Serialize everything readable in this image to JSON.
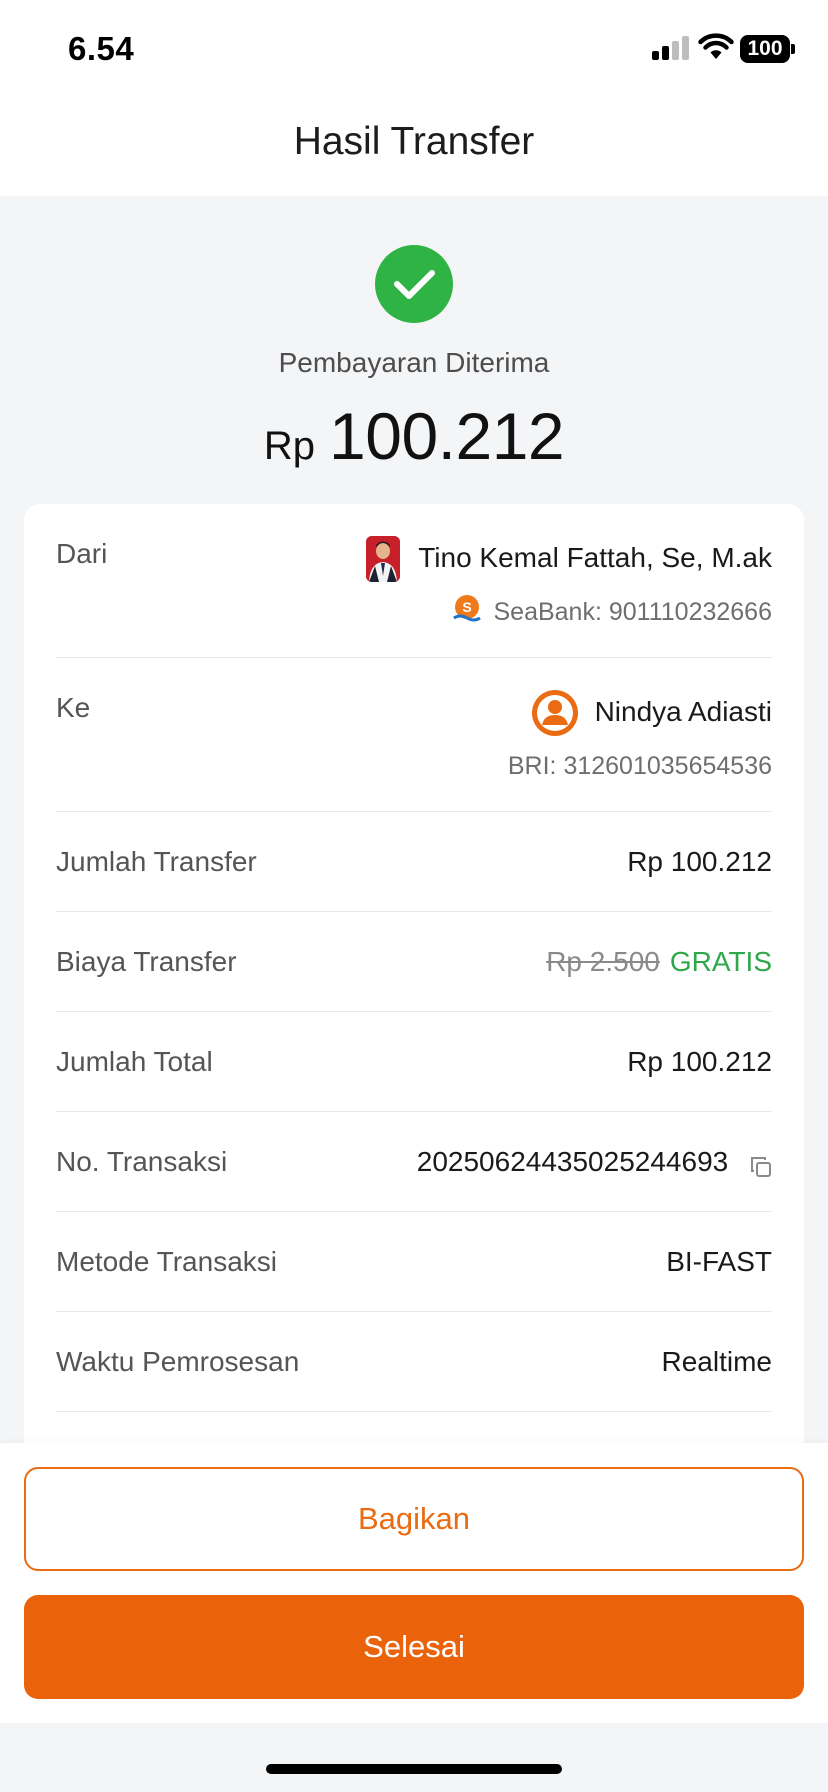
{
  "status_bar": {
    "time": "6.54",
    "battery_level": "100"
  },
  "header": {
    "title": "Hasil Transfer"
  },
  "result": {
    "status_text": "Pembayaran Diterima",
    "currency": "Rp",
    "amount": "100.212",
    "status_color": "#2fb344"
  },
  "details": {
    "from": {
      "label": "Dari",
      "name": "Tino Kemal Fattah, Se, M.ak",
      "account": "SeaBank: 901110232666",
      "bank_logo_letter": "S"
    },
    "to": {
      "label": "Ke",
      "name": "Nindya Adiasti",
      "account": "BRI: 312601035654536"
    },
    "transfer_amount": {
      "label": "Jumlah Transfer",
      "value": "Rp 100.212"
    },
    "fee": {
      "label": "Biaya Transfer",
      "original": "Rp 2.500",
      "value": "GRATIS"
    },
    "total": {
      "label": "Jumlah Total",
      "value": "Rp 100.212"
    },
    "transaction_no": {
      "label": "No. Transaksi",
      "value": "20250624435025244693"
    },
    "method": {
      "label": "Metode Transaksi",
      "value": "BI-FAST"
    },
    "processing_time": {
      "label": "Waktu Pemrosesan",
      "value": "Realtime"
    }
  },
  "actions": {
    "share_label": "Bagikan",
    "done_label": "Selesai"
  },
  "colors": {
    "accent": "#ea6209",
    "success": "#2fb344",
    "free": "#2fa84a"
  }
}
